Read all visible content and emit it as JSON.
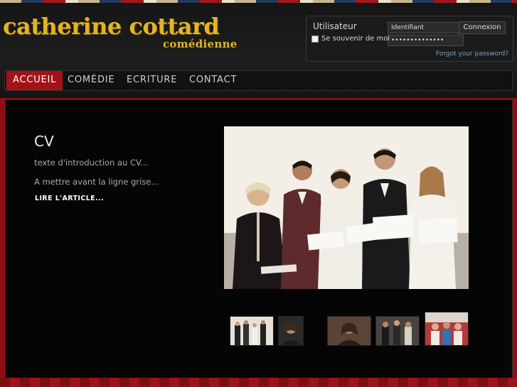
{
  "site": {
    "name": "catherine cottard",
    "subtitle": "comédienne"
  },
  "login": {
    "title": "Utilisateur",
    "username_value": "Identifiant",
    "password_value": "••••••••••••••",
    "button_label": "Connexion",
    "remember_label": "Se souvenir de moi",
    "forgot_label": "Forgot your password?"
  },
  "nav": {
    "items": [
      {
        "label": "ACCUEIL",
        "active": true
      },
      {
        "label": "COMÉDIE",
        "active": false
      },
      {
        "label": "ECRITURE",
        "active": false
      },
      {
        "label": "CONTACT",
        "active": false
      }
    ]
  },
  "article": {
    "title": "CV",
    "intro": "texte d'introduction au CV...",
    "line2": "A mettre avant la ligne grise...",
    "read_more": "LIRE L'ARTICLE..."
  },
  "colors": {
    "accent_red": "#a31217",
    "logo_gold": "#e2b526",
    "background": "#050505"
  }
}
